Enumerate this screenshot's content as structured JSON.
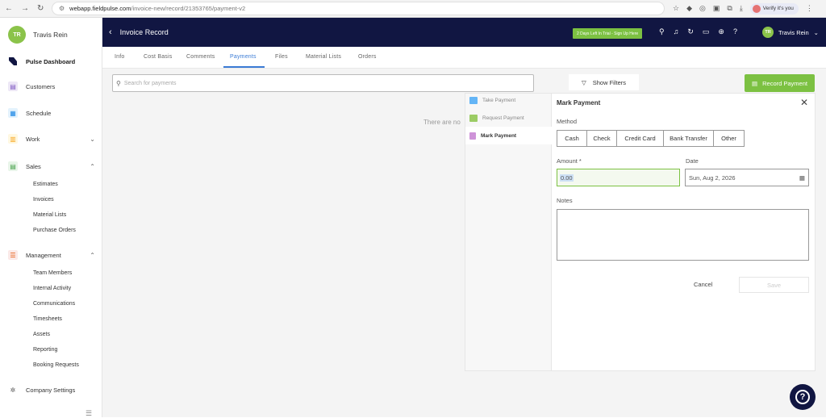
{
  "browser": {
    "url_host": "webapp.fieldpulse.com",
    "url_path": "/invoice-new/record/21353765/payment-v2",
    "verify_label": "Verify it's you"
  },
  "sidebar": {
    "user_initials": "TR",
    "user_name": "Travis Rein",
    "items": [
      {
        "label": "Pulse Dashboard",
        "icon": "dashboard-icon",
        "color": "#111642"
      },
      {
        "label": "Customers",
        "icon": "customers-icon",
        "color": "#7e57c2"
      },
      {
        "label": "Schedule",
        "icon": "calendar-icon",
        "color": "#1e88e5"
      },
      {
        "label": "Work",
        "icon": "work-icon",
        "color": "#f9a825"
      },
      {
        "label": "Sales",
        "icon": "sales-icon",
        "color": "#43a047"
      },
      {
        "label": "Management",
        "icon": "management-icon",
        "color": "#e65100"
      },
      {
        "label": "Company Settings",
        "icon": "gear-icon",
        "color": "#555555"
      }
    ],
    "sales_sub": [
      "Estimates",
      "Invoices",
      "Material Lists",
      "Purchase Orders"
    ],
    "management_sub": [
      "Team Members",
      "Internal Activity",
      "Communications",
      "Timesheets",
      "Assets",
      "Reporting",
      "Booking Requests"
    ]
  },
  "topbar": {
    "title": "Invoice Record",
    "trial_label": "2 Days Left In Trial - Sign Up Here",
    "user_initials": "TR",
    "user_name": "Travis Rein"
  },
  "tabs": [
    "Info",
    "Cost Basis",
    "Comments",
    "Payments",
    "Files",
    "Material Lists",
    "Orders"
  ],
  "toolbar": {
    "search_placeholder": "Search for payments",
    "filters_label": "Show Filters",
    "record_label": "Record Payment"
  },
  "empty_text": "There are no",
  "payment_menu": [
    "Take Payment",
    "Request Payment",
    "Mark Payment"
  ],
  "form": {
    "title": "Mark Payment",
    "method_label": "Method",
    "methods": [
      "Cash",
      "Check",
      "Credit Card",
      "Bank Transfer",
      "Other"
    ],
    "amount_label": "Amount *",
    "amount_value": "0.00",
    "date_label": "Date",
    "date_value": "Sun, Aug 2, 2026",
    "notes_label": "Notes",
    "cancel_label": "Cancel",
    "save_label": "Save"
  },
  "colors": {
    "accent": "#7cc142",
    "navy": "#111642",
    "tab_active": "#3a7bd5"
  }
}
